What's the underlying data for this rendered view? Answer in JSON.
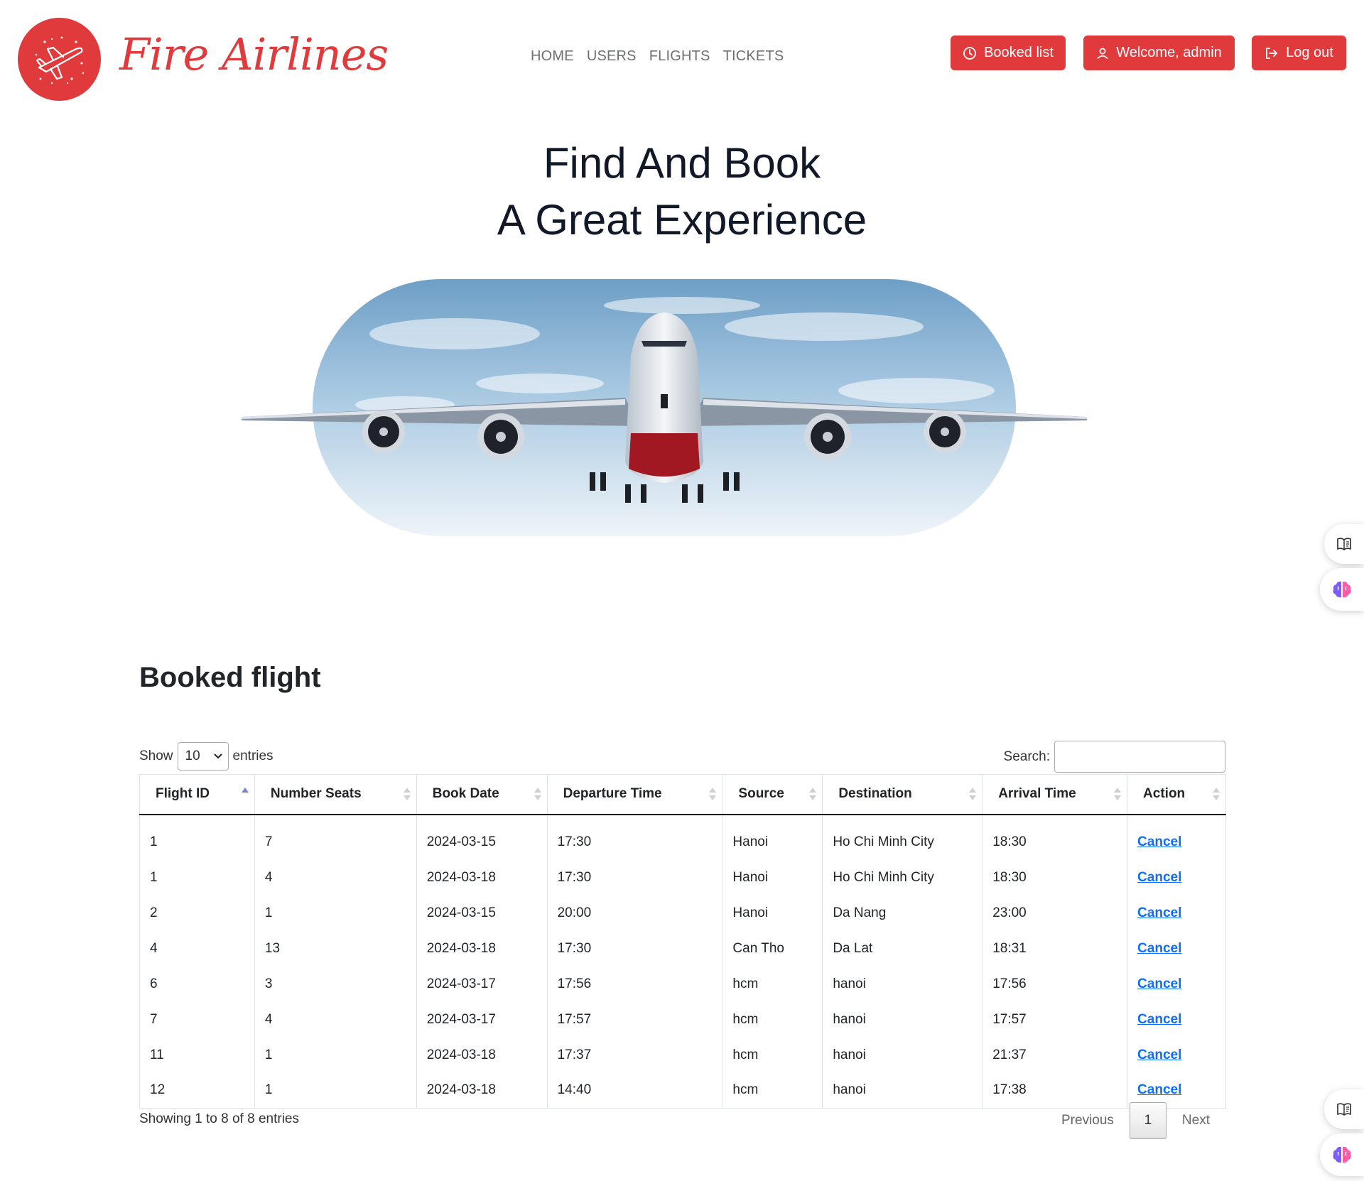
{
  "brand": {
    "name": "Fire Airlines"
  },
  "nav": {
    "home": "HOME",
    "users": "USERS",
    "flights": "FLIGHTS",
    "tickets": "TICKETS"
  },
  "header_buttons": {
    "booked": "Booked list",
    "welcome": "Welcome, admin",
    "logout": "Log out"
  },
  "hero": {
    "line1": "Find And Book",
    "line2": "A Great Experience"
  },
  "section": {
    "title": "Booked flight"
  },
  "table_controls": {
    "show_label": "Show",
    "page_size": "10",
    "entries_label": "entries",
    "search_label": "Search:",
    "search_value": ""
  },
  "table": {
    "columns": [
      "Flight ID",
      "Number Seats",
      "Book Date",
      "Departure Time",
      "Source",
      "Destination",
      "Arrival Time",
      "Action"
    ],
    "sorted_column": "Flight ID",
    "rows": [
      [
        "1",
        "7",
        "2024-03-15",
        "17:30",
        "Hanoi",
        "Ho Chi Minh City",
        "18:30",
        "Cancel"
      ],
      [
        "1",
        "4",
        "2024-03-18",
        "17:30",
        "Hanoi",
        "Ho Chi Minh City",
        "18:30",
        "Cancel"
      ],
      [
        "2",
        "1",
        "2024-03-15",
        "20:00",
        "Hanoi",
        "Da Nang",
        "23:00",
        "Cancel"
      ],
      [
        "4",
        "13",
        "2024-03-18",
        "17:30",
        "Can Tho",
        "Da Lat",
        "18:31",
        "Cancel"
      ],
      [
        "6",
        "3",
        "2024-03-17",
        "17:56",
        "hcm",
        "hanoi",
        "17:56",
        "Cancel"
      ],
      [
        "7",
        "4",
        "2024-03-17",
        "17:57",
        "hcm",
        "hanoi",
        "17:57",
        "Cancel"
      ],
      [
        "11",
        "1",
        "2024-03-18",
        "17:37",
        "hcm",
        "hanoi",
        "21:37",
        "Cancel"
      ],
      [
        "12",
        "1",
        "2024-03-18",
        "14:40",
        "hcm",
        "hanoi",
        "17:38",
        "Cancel"
      ]
    ]
  },
  "footer": {
    "info": "Showing 1 to 8 of 8 entries",
    "previous": "Previous",
    "current_page": "1",
    "next": "Next"
  },
  "colors": {
    "brand_red": "#e03a3c",
    "link_blue": "#0d6efd",
    "title_dark": "#111827"
  },
  "icons": {
    "logo": "airplane-stars-icon",
    "booked": "clock-icon",
    "welcome": "user-icon",
    "logout": "logout-icon",
    "side1": "book-open-icon",
    "side2": "brain-icon"
  }
}
